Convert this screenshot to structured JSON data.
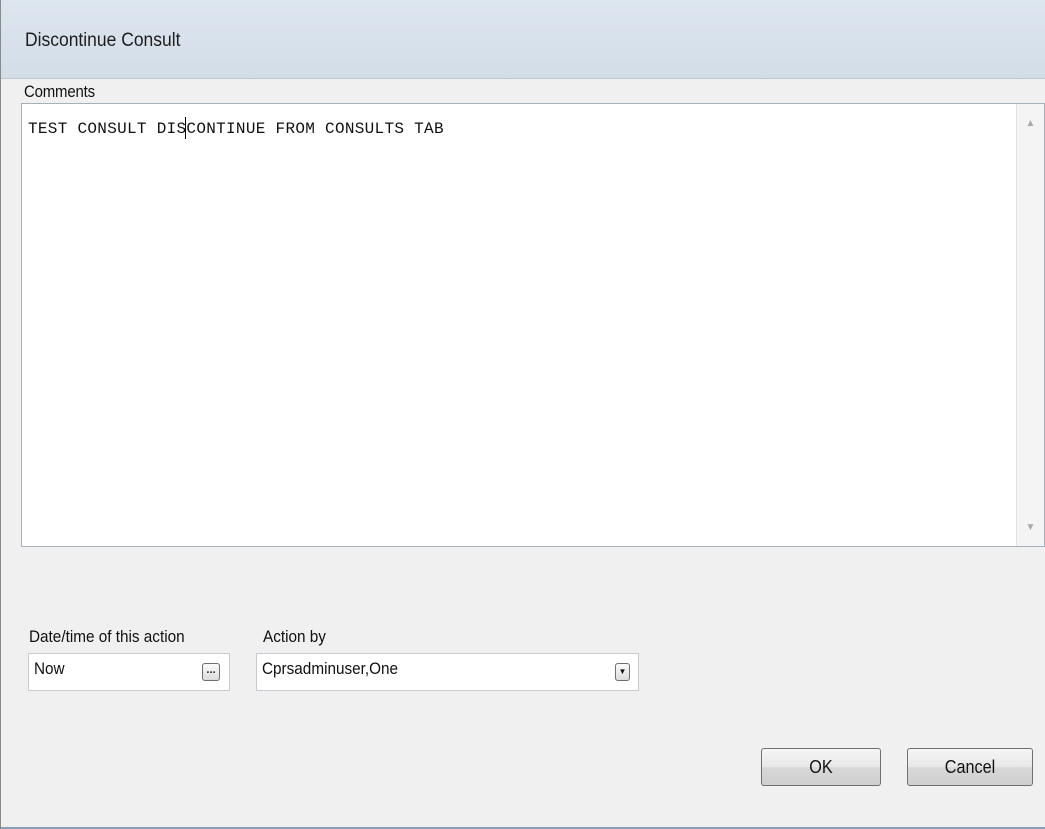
{
  "window": {
    "title": "Discontinue Consult"
  },
  "comments": {
    "label": "Comments",
    "text": "TEST CONSULT DISCONTINUE FROM CONSULTS TAB"
  },
  "datetime": {
    "label": "Date/time of this action",
    "value": "Now",
    "button_glyph": "..."
  },
  "action_by": {
    "label": "Action by",
    "value": "Cprsadminuser,One"
  },
  "buttons": {
    "ok": "OK",
    "cancel": "Cancel"
  },
  "icons": {
    "scroll_up": "scroll-up-arrow-icon",
    "scroll_down": "scroll-down-arrow-icon",
    "dropdown": "chevron-down-icon",
    "ellipsis": "ellipsis-icon"
  }
}
